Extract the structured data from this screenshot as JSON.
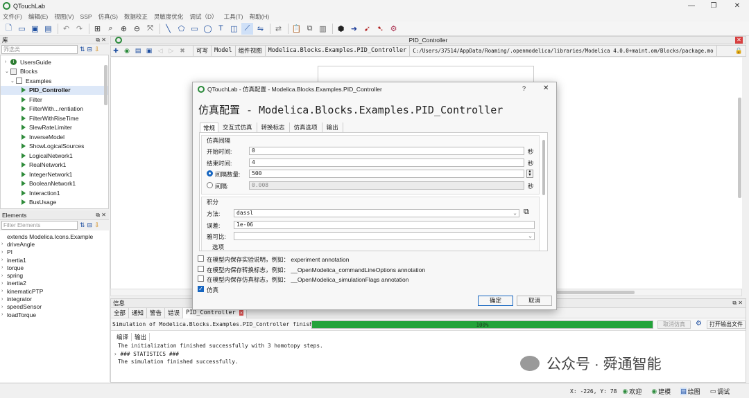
{
  "window": {
    "title": "QTouchLab"
  },
  "menu": [
    "文件(F)",
    "编辑(E)",
    "视图(V)",
    "SSP",
    "仿真(S)",
    "数据校正",
    "灵敏度优化",
    "调试（D）",
    "工具(T)",
    "帮助(H)"
  ],
  "library_panel": {
    "title": "库",
    "filter_placeholder": "筛选类",
    "items": [
      {
        "label": "UsersGuide",
        "kind": "info",
        "indent": 1,
        "expander": "›"
      },
      {
        "label": "Blocks",
        "kind": "package",
        "indent": 1,
        "expander": "⌄"
      },
      {
        "label": "Examples",
        "kind": "examples",
        "indent": 2,
        "expander": "⌄"
      },
      {
        "label": "PID_Controller",
        "kind": "model",
        "indent": 3,
        "expander": "",
        "selected": true
      },
      {
        "label": "Filter",
        "kind": "model",
        "indent": 3,
        "expander": ""
      },
      {
        "label": "FilterWith...rentiation",
        "kind": "model",
        "indent": 3,
        "expander": ""
      },
      {
        "label": "FilterWithRiseTime",
        "kind": "model",
        "indent": 3,
        "expander": ""
      },
      {
        "label": "SlewRateLimiter",
        "kind": "model",
        "indent": 3,
        "expander": ""
      },
      {
        "label": "InverseModel",
        "kind": "model",
        "indent": 3,
        "expander": ""
      },
      {
        "label": "ShowLogicalSources",
        "kind": "model",
        "indent": 3,
        "expander": ""
      },
      {
        "label": "LogicalNetwork1",
        "kind": "model",
        "indent": 3,
        "expander": ""
      },
      {
        "label": "RealNetwork1",
        "kind": "model",
        "indent": 3,
        "expander": ""
      },
      {
        "label": "IntegerNetwork1",
        "kind": "model",
        "indent": 3,
        "expander": ""
      },
      {
        "label": "BooleanNetwork1",
        "kind": "model",
        "indent": 3,
        "expander": ""
      },
      {
        "label": "Interaction1",
        "kind": "model",
        "indent": 3,
        "expander": ""
      },
      {
        "label": "BusUsage",
        "kind": "model",
        "indent": 3,
        "expander": ""
      }
    ]
  },
  "elements_panel": {
    "title": "Elements",
    "filter_placeholder": "Filter Elements",
    "items": [
      "extends Modelica.Icons.Example",
      "driveAngle",
      "PI",
      "inertia1",
      "torque",
      "spring",
      "inertia2",
      "kinematicPTP",
      "integrator",
      "speedSensor",
      "loadTorque"
    ]
  },
  "editor": {
    "title": "PID_Controller",
    "tabs": [
      "可写",
      "Model",
      "组件视图",
      "Modelica.Blocks.Examples.PID_Controller",
      "C:/Users/37514/AppData/Roaming/.openmodelica/libraries/Modelica 4.0.0+maint.om/Blocks/package.mo"
    ]
  },
  "dialog": {
    "window_title": "QTouchLab - 仿真配置 - Modelica.Blocks.Examples.PID_Controller",
    "heading": "仿真配置 - Modelica.Blocks.Examples.PID_Controller",
    "help": "?",
    "tabs": [
      "常规",
      "交互式仿真",
      "转换标志",
      "仿真选项",
      "输出"
    ],
    "active_tab": "常规",
    "interval_group": "仿真间隔",
    "start_label": "开始时间:",
    "start_value": "0",
    "start_unit": "秒",
    "stop_label": "结束时间:",
    "stop_value": "4",
    "stop_unit": "秒",
    "count_label": "间隔数量:",
    "count_value": "500",
    "interval_label": "间隔:",
    "interval_value": "0.008",
    "interval_unit": "秒",
    "integration_group": "积分",
    "method_label": "方法:",
    "method_value": "dassl",
    "tolerance_label": "误差:",
    "tolerance_value": "1e-06",
    "jacobian_label": "雅可比:",
    "jacobian_value": "",
    "options_label": "选项",
    "checks": [
      {
        "label": "在模型内保存实验说明，例如： experiment annotation",
        "checked": false
      },
      {
        "label": "在模型内保存转换标志，例如： __OpenModelica_commandLineOptions annotation",
        "checked": false
      },
      {
        "label": "在模型内保存仿真标志，例如： __OpenModelica_simulationFlags annotation",
        "checked": false
      },
      {
        "label": "仿真",
        "checked": true
      }
    ],
    "ok": "确定",
    "cancel": "取消"
  },
  "messages": {
    "title": "信息",
    "tabs": [
      "全部",
      "通知",
      "警告",
      "错误",
      "PID_Controller"
    ],
    "sim_status": "Simulation of Modelica.Blocks.Examples.PID_Controller finished.",
    "progress": 100,
    "progress_text": "100%",
    "cancel_sim": "取消仿真",
    "open_output": "打开输出文件",
    "subtabs": [
      "编译",
      "输出"
    ],
    "log": [
      "The initialization finished successfully with 3 homotopy steps.",
      "### STATISTICS ###",
      "The simulation finished successfully."
    ]
  },
  "watermark": "公众号 · 舜通智能",
  "status": {
    "coords": "X: -226, Y: 78",
    "welcome": "欢迎",
    "model": "建模",
    "plot": "绘图",
    "debug": "调试"
  },
  "colors": {
    "accent": "#1565c0",
    "progress": "#23a33a",
    "logo": "#2a8a3a"
  }
}
